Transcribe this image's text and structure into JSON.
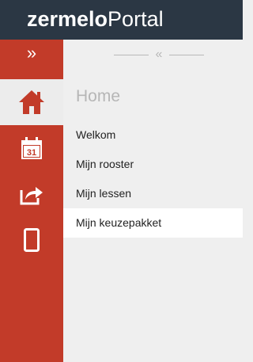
{
  "header": {
    "logo_bold": "zermelo",
    "logo_light": "Portal"
  },
  "rail": {
    "toggle_label": "»",
    "items": [
      {
        "icon": "home-icon",
        "active": true
      },
      {
        "icon": "calendar-icon",
        "day": "31",
        "active": false
      },
      {
        "icon": "share-icon",
        "active": false
      },
      {
        "icon": "mobile-icon",
        "active": false
      }
    ]
  },
  "main": {
    "collapse_label": "«",
    "section_title": "Home",
    "menu": [
      {
        "label": "Welkom",
        "selected": false
      },
      {
        "label": "Mijn rooster",
        "selected": false
      },
      {
        "label": "Mijn lessen",
        "selected": false
      },
      {
        "label": "Mijn keuzepakket",
        "selected": true
      }
    ]
  },
  "colors": {
    "accent": "#c23b29",
    "header_bg": "#2b3744"
  }
}
